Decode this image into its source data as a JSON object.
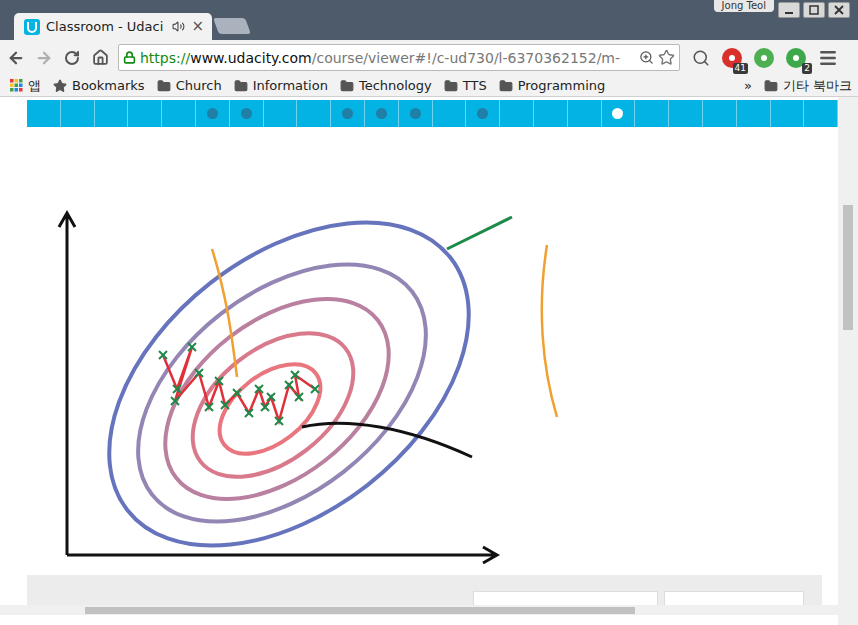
{
  "window": {
    "user": "Jong Teol"
  },
  "tabs": [
    {
      "title": "Classroom - Udaci",
      "close": "×",
      "selected": true,
      "audio": true
    }
  ],
  "address": {
    "scheme": "https://",
    "host": "www.udacity.com",
    "path": "/course/viewer#!/c-ud730/l-6370362152/m-"
  },
  "extensions": [
    {
      "badge": "41",
      "color": "#d9302c"
    },
    {
      "badge": "",
      "color": "#4caf50"
    },
    {
      "badge": "2",
      "color": "#3fa84a"
    }
  ],
  "bookmarks": [
    {
      "label": "앱",
      "kind": "apps"
    },
    {
      "label": "Bookmarks",
      "kind": "star"
    },
    {
      "label": "Church",
      "kind": "folder"
    },
    {
      "label": "Information",
      "kind": "folder"
    },
    {
      "label": "Technology",
      "kind": "folder"
    },
    {
      "label": "TTS",
      "kind": "folder"
    },
    {
      "label": "Programming",
      "kind": "folder"
    }
  ],
  "bookmarks_overflow": "»",
  "other_bookmarks": "기타 북마크",
  "progress": [
    {
      "visited": false,
      "selected": false
    },
    {
      "visited": false,
      "selected": false
    },
    {
      "visited": false,
      "selected": false
    },
    {
      "visited": false,
      "selected": false
    },
    {
      "visited": false,
      "selected": false
    },
    {
      "visited": true,
      "selected": false
    },
    {
      "visited": true,
      "selected": false
    },
    {
      "visited": false,
      "selected": false
    },
    {
      "visited": false,
      "selected": false
    },
    {
      "visited": true,
      "selected": false
    },
    {
      "visited": true,
      "selected": false
    },
    {
      "visited": true,
      "selected": false
    },
    {
      "visited": false,
      "selected": false
    },
    {
      "visited": true,
      "selected": false
    },
    {
      "visited": false,
      "selected": false
    },
    {
      "visited": false,
      "selected": false
    },
    {
      "visited": false,
      "selected": false
    },
    {
      "visited": false,
      "selected": true
    },
    {
      "visited": false,
      "selected": false
    },
    {
      "visited": false,
      "selected": false
    },
    {
      "visited": false,
      "selected": false
    },
    {
      "visited": false,
      "selected": false
    },
    {
      "visited": false,
      "selected": false
    },
    {
      "visited": false,
      "selected": false
    }
  ]
}
